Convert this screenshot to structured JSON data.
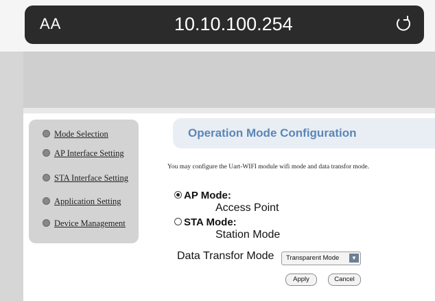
{
  "browser": {
    "text_size_button": "AA",
    "url": "10.10.100.254",
    "reload_icon": "reload-icon"
  },
  "sidebar": {
    "items": [
      {
        "label": "Mode Selection"
      },
      {
        "label": "AP Interface Setting"
      },
      {
        "label": "STA Interface Setting"
      },
      {
        "label": "Application Setting"
      },
      {
        "label": "Device Management"
      }
    ]
  },
  "main": {
    "title": "Operation Mode Configuration",
    "description": "You may configure the Uart-WIFI module wifi mode and data transfor mode.",
    "modes": [
      {
        "label": "AP Mode:",
        "sublabel": "Access Point",
        "checked": true
      },
      {
        "label": "STA Mode:",
        "sublabel": "Station Mode",
        "checked": false
      }
    ],
    "data_transfor_label": "Data Transfor Mode",
    "data_transfor_value": "Transparent Mode",
    "apply_label": "Apply",
    "cancel_label": "Cancel"
  },
  "colors": {
    "title": "#5b86b8",
    "address_bar": "#2b2b2b",
    "sidebar_bg": "#d3d3d3"
  }
}
